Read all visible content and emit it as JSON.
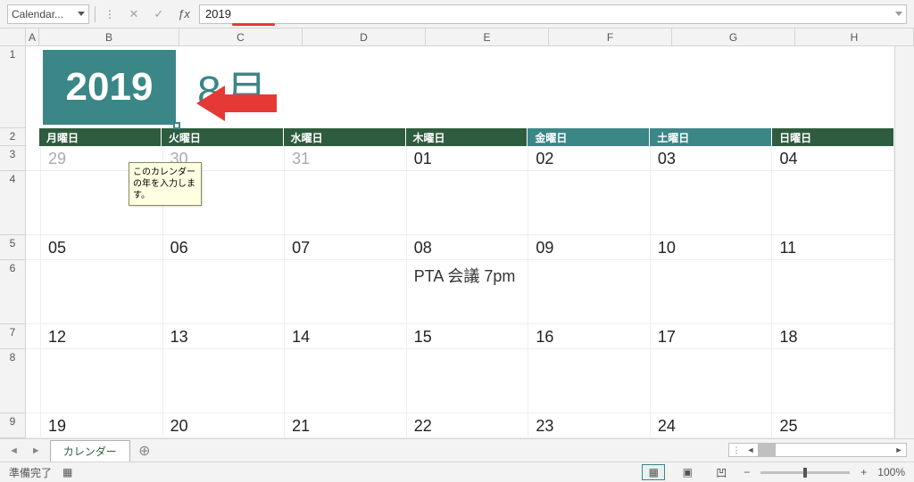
{
  "formula_bar": {
    "name_box": "Calendar...",
    "fx_value": "2019"
  },
  "cells": {
    "year": "2019",
    "month": "8月",
    "tooltip": "このカレンダーの年を入力します。",
    "event_08": "PTA 会議 7pm"
  },
  "dow": [
    "月曜日",
    "火曜日",
    "水曜日",
    "木曜日",
    "金曜日",
    "土曜日",
    "日曜日"
  ],
  "cols": [
    "A",
    "B",
    "C",
    "D",
    "E",
    "F",
    "G",
    "H"
  ],
  "rows": [
    "1",
    "2",
    "3",
    "4",
    "5",
    "6",
    "7",
    "8",
    "9"
  ],
  "weeks": [
    {
      "dates": [
        "29",
        "30",
        "31",
        "01",
        "02",
        "03",
        "04"
      ],
      "gray": [
        0,
        1,
        2
      ]
    },
    {
      "dates": [
        "05",
        "06",
        "07",
        "08",
        "09",
        "10",
        "11"
      ],
      "gray": []
    },
    {
      "dates": [
        "12",
        "13",
        "14",
        "15",
        "16",
        "17",
        "18"
      ],
      "gray": []
    },
    {
      "dates": [
        "19",
        "20",
        "21",
        "22",
        "23",
        "24",
        "25"
      ],
      "gray": []
    }
  ],
  "tabs": {
    "active": "カレンダー"
  },
  "status": {
    "ready": "準備完了",
    "zoom": "100%"
  }
}
